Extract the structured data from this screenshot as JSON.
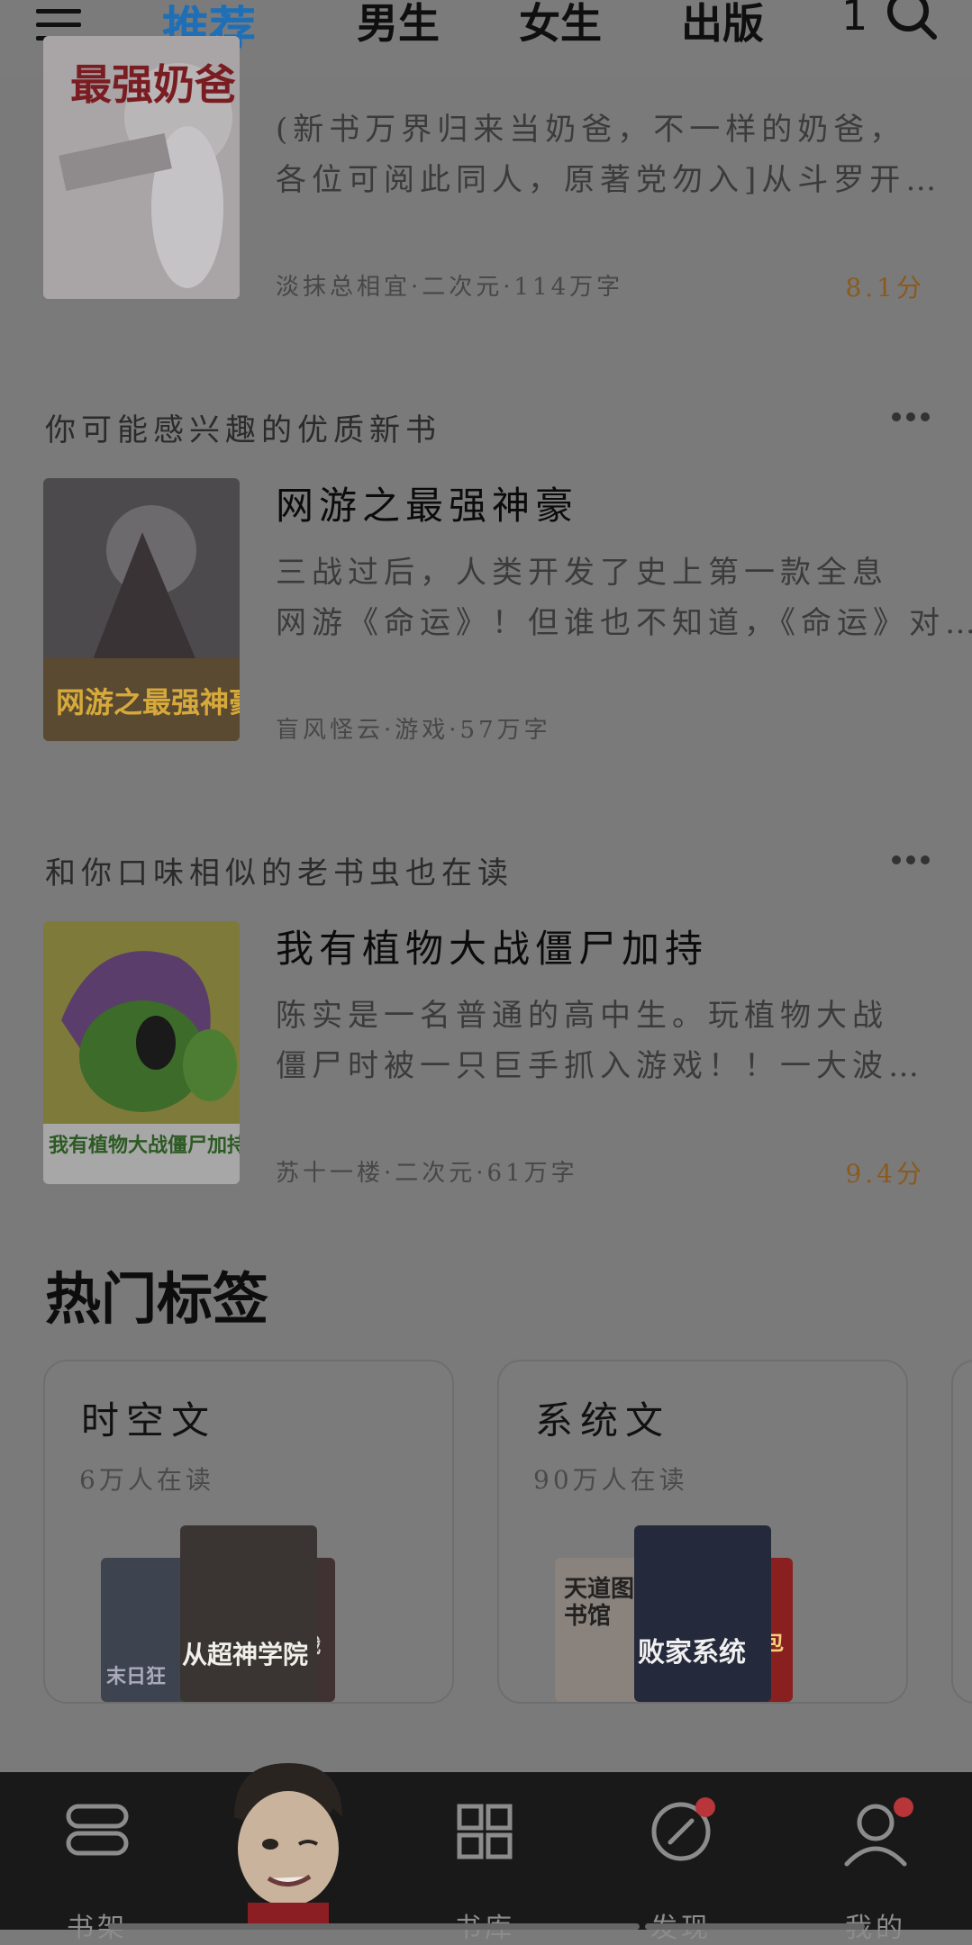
{
  "nav": {
    "tabs": [
      {
        "label": "推荐"
      },
      {
        "label": "男生"
      },
      {
        "label": "女生"
      },
      {
        "label": "出版"
      },
      {
        "label": "1"
      }
    ]
  },
  "books": [
    {
      "cover_text": "最强奶爸",
      "desc": "(新书万界归来当奶爸，不一样的奶爸，各位可阅此同人，原著党勿入]从斗罗开…",
      "desc_line1": "(新书万界归来当奶爸，不一样的奶爸，",
      "desc_line2": "各位可阅此同人，原著党勿入]从斗罗开…",
      "meta": "淡抹总相宜·二次元·114万字",
      "score": "8.1分"
    },
    {
      "section": "你可能感兴趣的优质新书",
      "title": "网游之最强神豪",
      "cover_text": "网游之最强神豪",
      "desc_line1": "三战过后，人类开发了史上第一款全息",
      "desc_line2": "网游《命运》！但谁也不知道，《命运》对…",
      "meta": "盲风怪云·游戏·57万字",
      "score": ""
    },
    {
      "section": "和你口味相似的老书虫也在读",
      "title": "我有植物大战僵尸加持",
      "cover_text": "我有植物大战僵尸加持",
      "desc_line1": "陈实是一名普通的高中生。玩植物大战",
      "desc_line2": "僵尸时被一只巨手抓入游戏！！一大波…",
      "meta": "苏十一楼·二次元·61万字",
      "score": "9.4分"
    }
  ],
  "hot_tags": {
    "title": "热门标签",
    "cards": [
      {
        "name": "时空文",
        "count": "6万人在读",
        "covers": [
          "末日狂",
          "从超神学院",
          "我的铁战衣"
        ]
      },
      {
        "name": "系统文",
        "count": "90万人在读",
        "covers": [
          "天道图书馆",
          "败家系统",
          "神界红包群"
        ]
      }
    ]
  },
  "bottom_nav": [
    {
      "label": "书架",
      "icon": "bookshelf-icon"
    },
    {
      "label": "书库",
      "icon": "library-grid-icon"
    },
    {
      "label": "发现",
      "icon": "compass-icon"
    },
    {
      "label": "我的",
      "icon": "profile-icon"
    }
  ],
  "colors": {
    "accent": "#1f6fb7",
    "score": "#8a5a1e",
    "badge": "#b8353a"
  }
}
